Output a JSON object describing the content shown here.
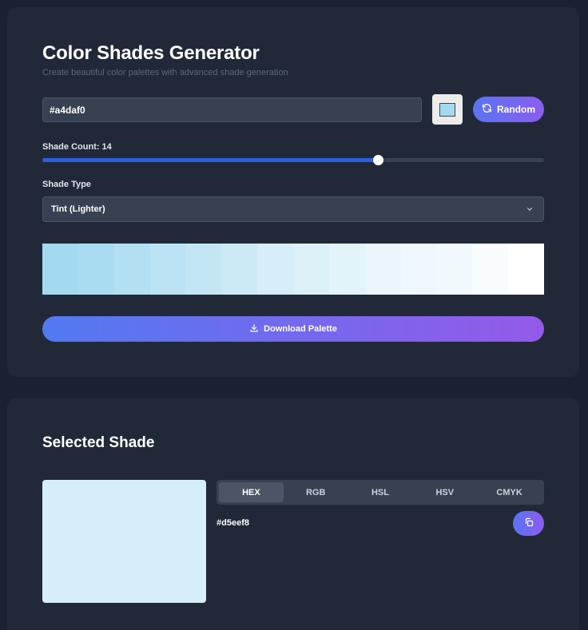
{
  "generator": {
    "title": "Color Shades Generator",
    "subtitle": "Create beautiful color palettes with advanced shade generation",
    "hex_value": "#a4daf0",
    "base_color": "#a4daf0",
    "random_label": "Random",
    "shade_count_label": "Shade Count: 14",
    "shade_count_fraction": 0.669,
    "shade_type_label": "Shade Type",
    "shade_type_selected": "Tint (Lighter)",
    "palette": [
      "#a4daf0",
      "#a9dcf0",
      "#b2dff1",
      "#bbe3f3",
      "#c3e6f4",
      "#cceaf6",
      "#d5eef8",
      "#dcf0f8",
      "#e3f3fa",
      "#eaf6fb",
      "#eef7fb",
      "#f2f9fc",
      "#f8fcfd",
      "#ffffff"
    ],
    "download_label": "Download Palette"
  },
  "selected": {
    "title": "Selected Shade",
    "color": "#d5eef8",
    "tabs": [
      "HEX",
      "RGB",
      "HSL",
      "HSV",
      "CMYK"
    ],
    "active_tab": "HEX",
    "value": "#d5eef8"
  },
  "colors": {
    "accent_gradient_start": "#5b74f4",
    "accent_gradient_end": "#8b5cf0",
    "slider_fill": "#2c5fe0"
  },
  "icons": {
    "random": "refresh-icon",
    "download": "download-icon",
    "select": "chevron-down-icon",
    "copy": "copy-icon"
  }
}
